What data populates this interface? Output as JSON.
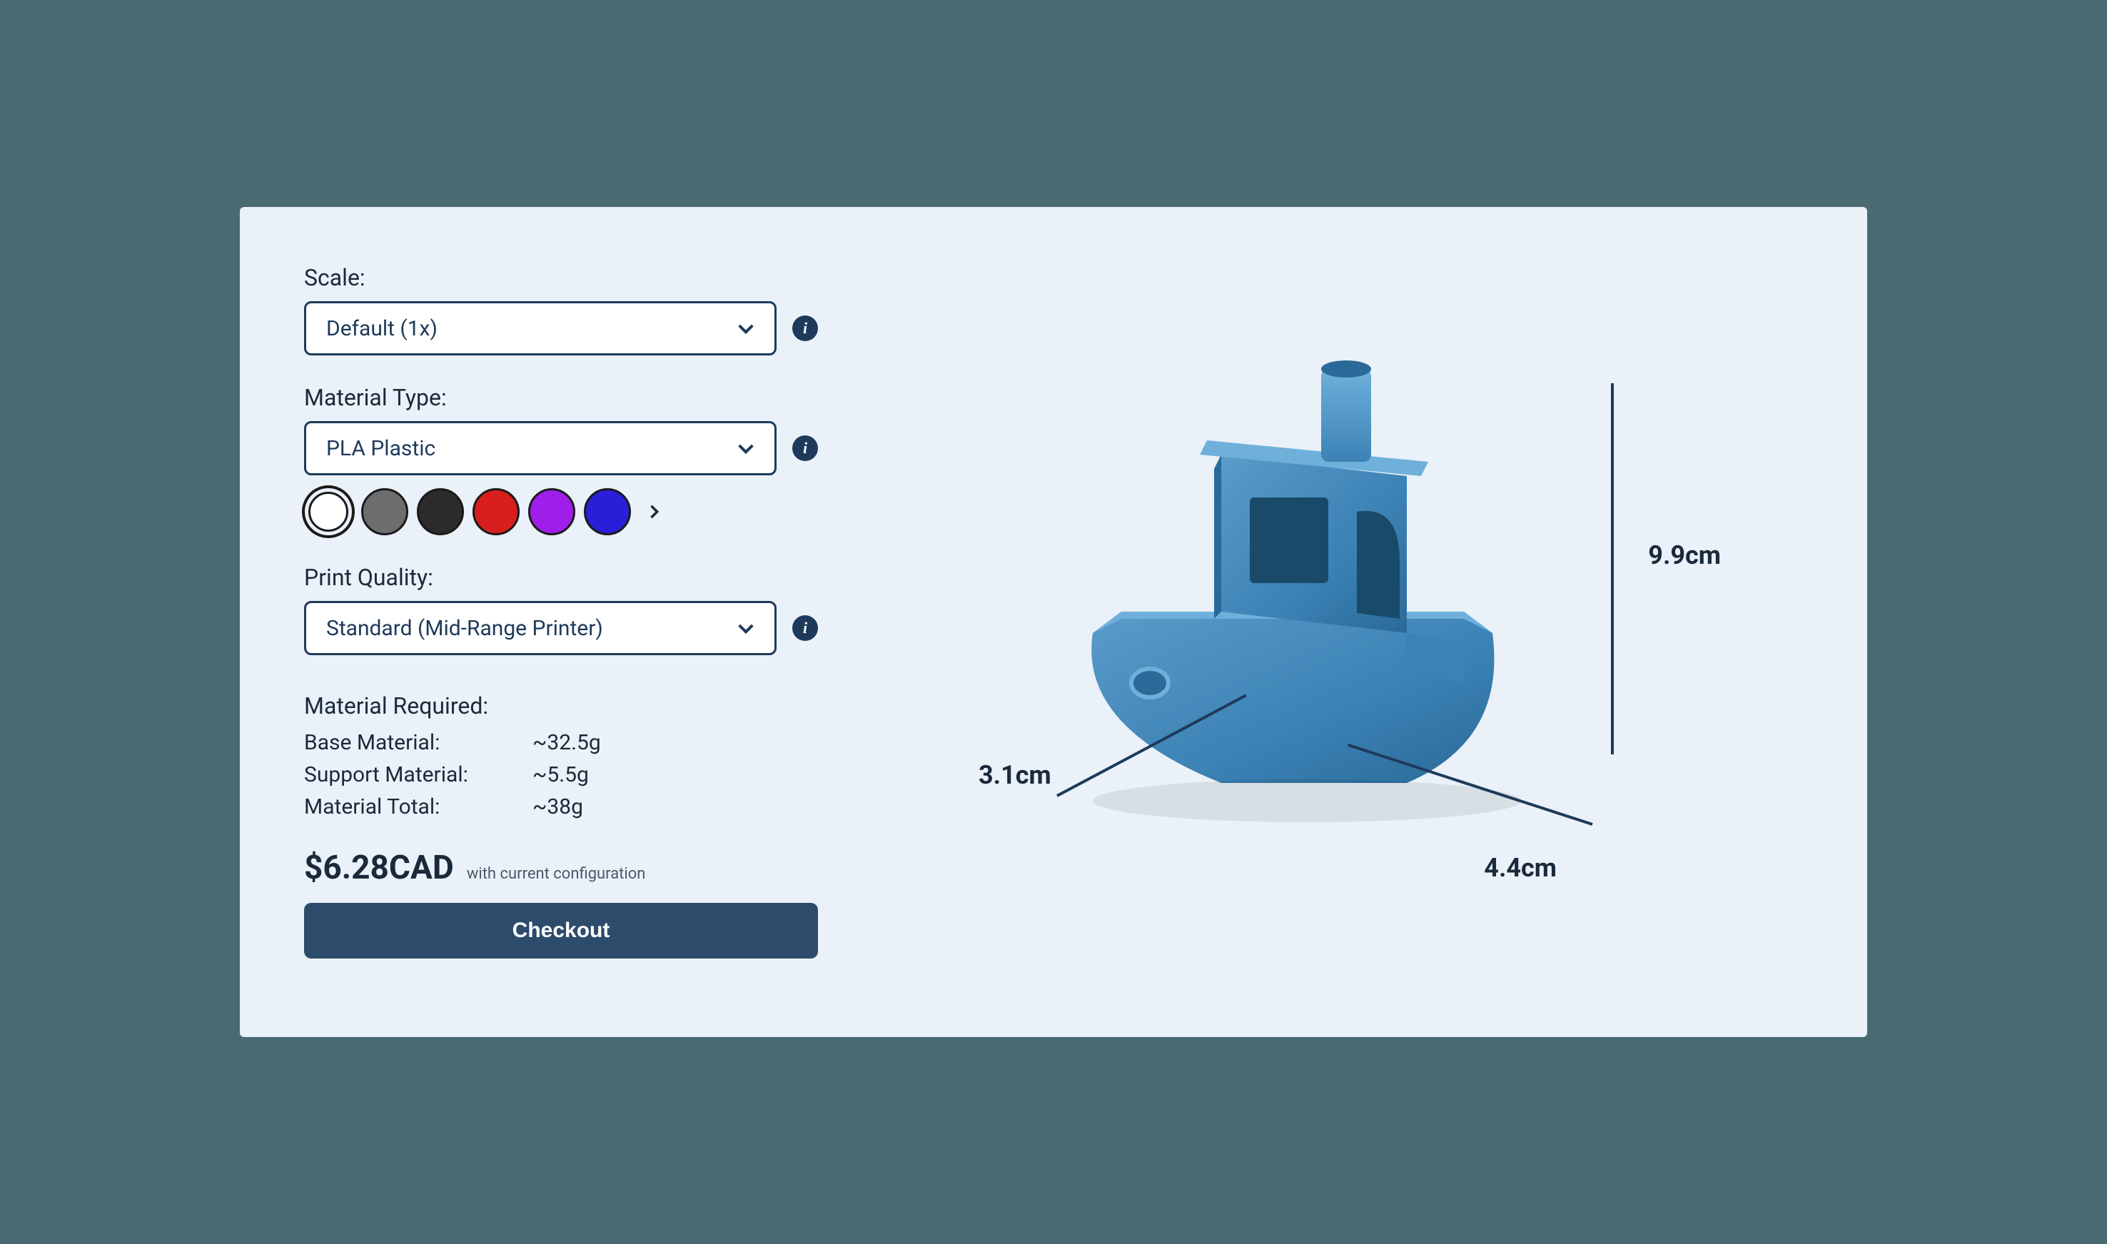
{
  "config": {
    "scale": {
      "label": "Scale:",
      "value": "Default (1x)"
    },
    "material": {
      "label": "Material Type:",
      "value": "PLA Plastic"
    },
    "quality": {
      "label": "Print Quality:",
      "value": "Standard (Mid-Range Printer)"
    },
    "colors": [
      {
        "name": "white",
        "hex": "#ffffff",
        "selected": true
      },
      {
        "name": "grey",
        "hex": "#6d6d6d",
        "selected": false
      },
      {
        "name": "black",
        "hex": "#2b2b2b",
        "selected": false
      },
      {
        "name": "red",
        "hex": "#d91e1e",
        "selected": false
      },
      {
        "name": "purple",
        "hex": "#a01eea",
        "selected": false
      },
      {
        "name": "blue",
        "hex": "#2a1ed9",
        "selected": false
      }
    ]
  },
  "material_required": {
    "title": "Material Required:",
    "rows": [
      {
        "label": "Base Material:",
        "value": "~32.5g"
      },
      {
        "label": "Support Material:",
        "value": "~5.5g"
      },
      {
        "label": "Material Total:",
        "value": "~38g"
      }
    ]
  },
  "pricing": {
    "price": "$6.28CAD",
    "note": "with current configuration",
    "checkout_label": "Checkout"
  },
  "preview": {
    "dimensions": {
      "height": "9.9cm",
      "width": "4.4cm",
      "depth": "3.1cm"
    },
    "model_color": "#3b82b5"
  }
}
